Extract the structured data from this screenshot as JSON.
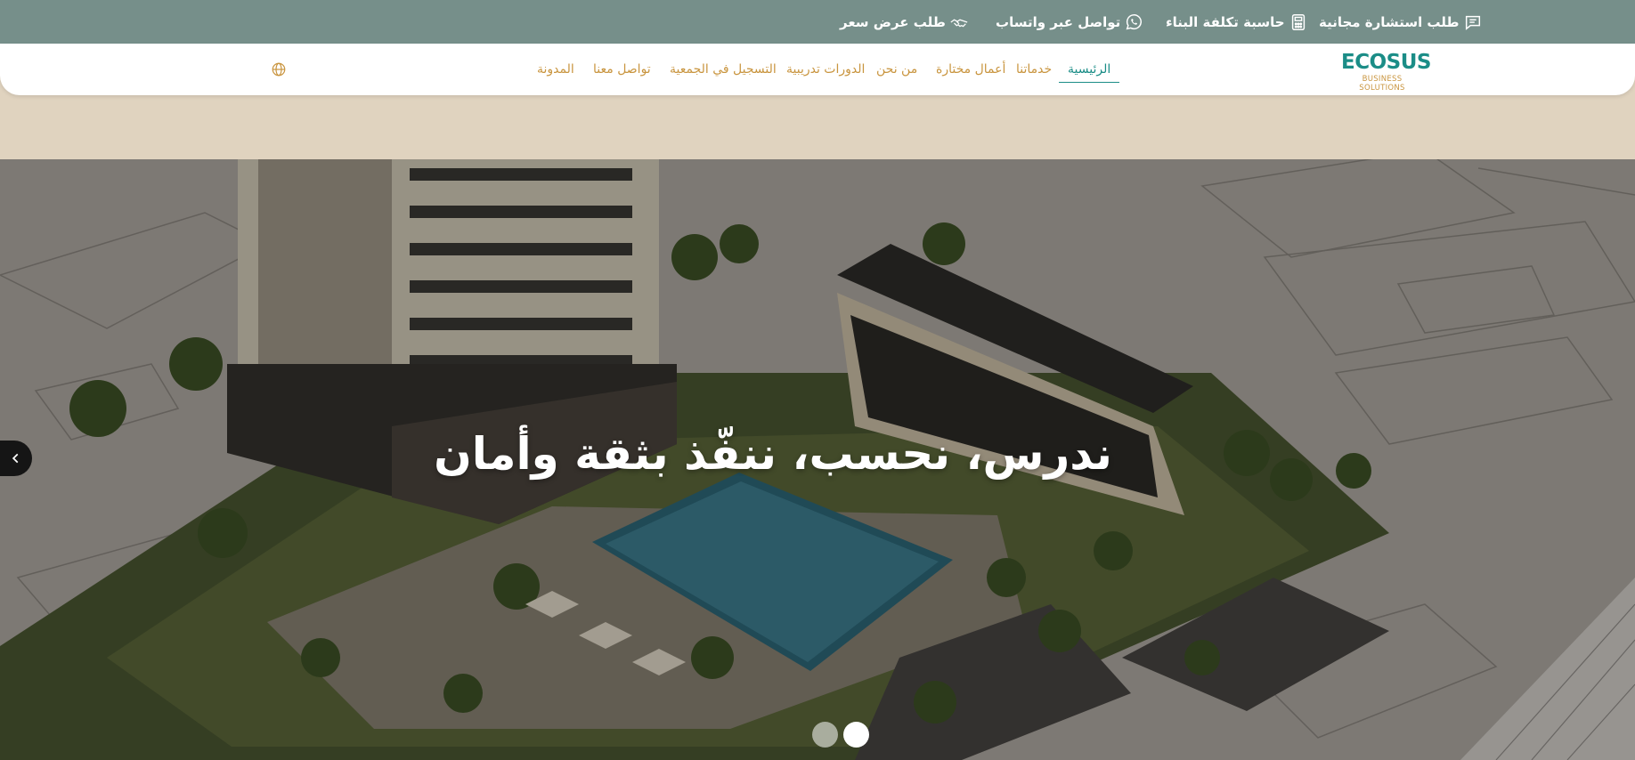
{
  "topbar": {
    "consultation": "طلب استشارة مجانية",
    "calculator": "حاسبة تكلفة البناء",
    "whatsapp": "تواصل عبر واتساب",
    "quote": "طلب عرض سعر"
  },
  "logo": {
    "word": "ECOSUS",
    "tagline": "BUSINESS SOLUTIONS"
  },
  "nav": {
    "home": "الرئيسية",
    "services": "خدماتنا",
    "works": "أعمال مختارة",
    "about": "من نحن",
    "courses": "الدورات تدريبية",
    "register": "التسجيل في الجمعية",
    "contact": "تواصل معنا",
    "blog": "المدونة"
  },
  "hero": {
    "title": "ندرس، نحسب، ننفّذ بثقة وأمان",
    "slide_count": 2,
    "active_slide": 2
  },
  "colors": {
    "topbar": "#768f8a",
    "accent_teal": "#1b8d87",
    "accent_gold": "#c9953f",
    "band": "#e0d3bf"
  }
}
